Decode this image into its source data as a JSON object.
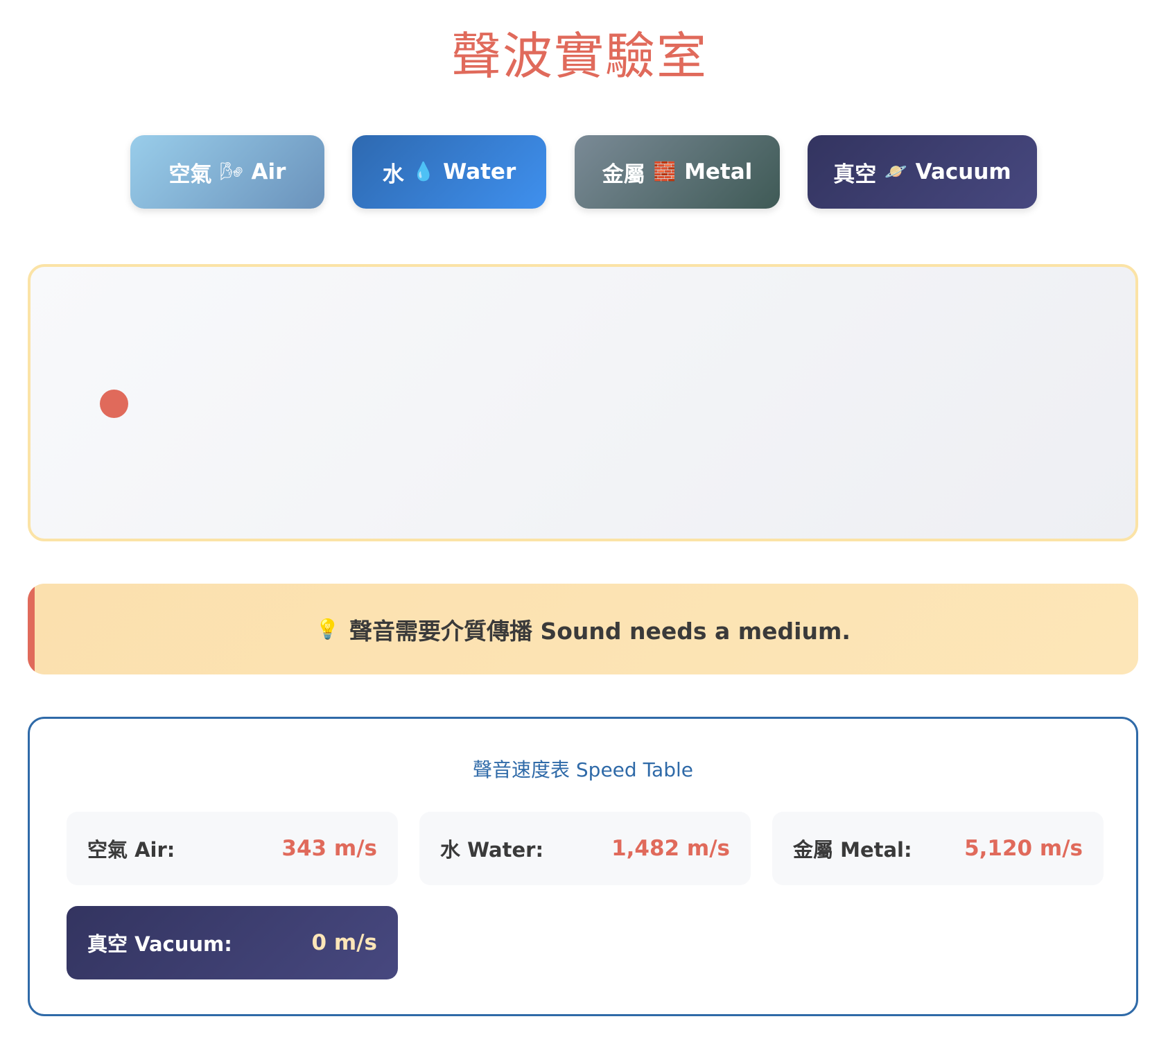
{
  "header": {
    "title": "聲波實驗室"
  },
  "media_buttons": [
    {
      "label_zh": "空氣",
      "icon": "🌬",
      "icon_name": "wind-icon",
      "label_en": "Air"
    },
    {
      "label_zh": "水",
      "icon": "💧",
      "icon_name": "droplet-icon",
      "label_en": "Water"
    },
    {
      "label_zh": "金屬",
      "icon": "🧱",
      "icon_name": "brick-icon",
      "label_en": "Metal"
    },
    {
      "label_zh": "真空",
      "icon": "🪐",
      "icon_name": "planet-icon",
      "label_en": "Vacuum"
    }
  ],
  "hint": {
    "icon": "💡",
    "icon_name": "lightbulb-icon",
    "text": "聲音需要介質傳播 Sound needs a medium."
  },
  "speed_table": {
    "title": "聲音速度表 Speed Table",
    "rows": [
      {
        "label": "空氣 Air:",
        "value": "343 m/s"
      },
      {
        "label": "水 Water:",
        "value": "1,482 m/s"
      },
      {
        "label": "金屬 Metal:",
        "value": "5,120 m/s"
      },
      {
        "label": "真空 Vacuum:",
        "value": "0 m/s"
      }
    ]
  },
  "colors": {
    "accent": "#e06a5b",
    "panel_border": "#2f6aa8",
    "stage_border": "#fbe3a6",
    "vacuum": "#3b3c6c"
  }
}
